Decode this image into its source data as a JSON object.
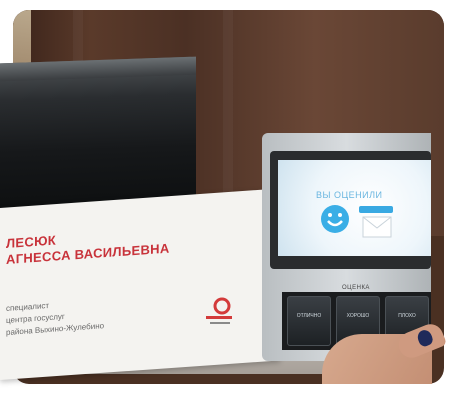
{
  "card": {
    "name_line1": "ЛЕСЮК",
    "name_line2": "АГНЕССА ВАСИЛЬЕВНА",
    "role_line1": "специалист",
    "role_line2": "центра госуслуг",
    "role_line3": "района Выхино-Жулебино"
  },
  "terminal": {
    "screen_title": "ВЫ ОЦЕНИЛИ",
    "brand_label": "ОЦЕНКА",
    "buttons": [
      "ОТЛИЧНО",
      "ХОРОШО",
      "ПЛОХО"
    ]
  },
  "colors": {
    "card_name": "#c8323a",
    "screen_accent": "#39a9e2",
    "nail": "#1f2a5a"
  }
}
